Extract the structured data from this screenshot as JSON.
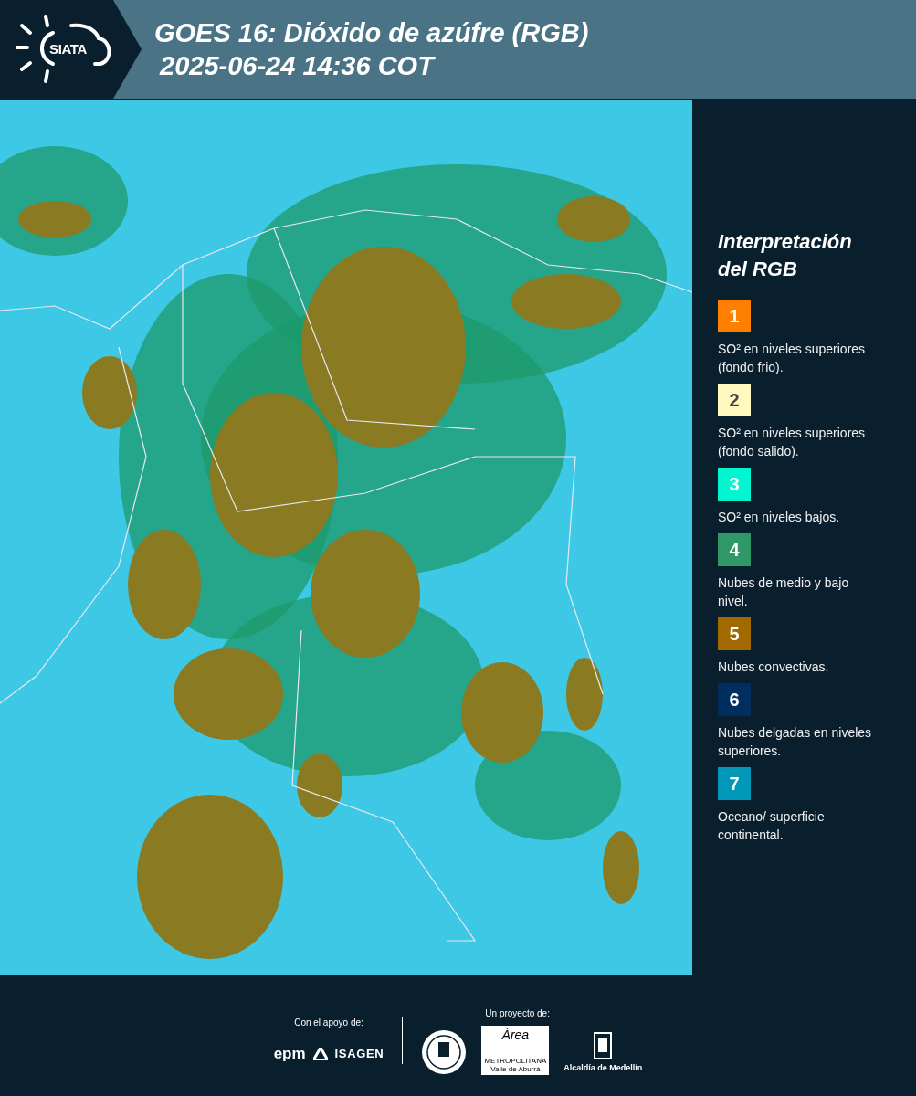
{
  "header": {
    "logo_text": "SIATA",
    "title_lines": [
      "GOES 16: Dióxido de azúfre (RGB)",
      "2025-06-24 14:36 COT"
    ]
  },
  "legend": {
    "title_lines": [
      "Interpretación",
      "del RGB"
    ],
    "items": [
      {
        "number": "1",
        "color": "#ff7f00",
        "text": "SO² en niveles superiores (fondo frio)."
      },
      {
        "number": "2",
        "color": "#fff9c0",
        "text": "SO² en niveles superiores (fondo salido)."
      },
      {
        "number": "3",
        "color": "#00f5d0",
        "text": "SO² en niveles bajos."
      },
      {
        "number": "4",
        "color": "#2e9866",
        "text": "Nubes de medio y bajo nivel."
      },
      {
        "number": "5",
        "color": "#a06a00",
        "text": "Nubes convectivas."
      },
      {
        "number": "6",
        "color": "#002f5f",
        "text": "Nubes delgadas en niveles superiores."
      },
      {
        "number": "7",
        "color": "#0097b8",
        "text": "Oceano/ superficie continental."
      }
    ]
  },
  "footer": {
    "support_label": "Con el apoyo de:",
    "project_label": "Un proyecto de:",
    "epm": "epm",
    "isagen": "ISAGEN",
    "area_name": "Área",
    "area_sub": [
      "METROPOLITANA",
      "Valle de Aburrá"
    ],
    "alcaldia": "Alcaldía de Medellín"
  }
}
